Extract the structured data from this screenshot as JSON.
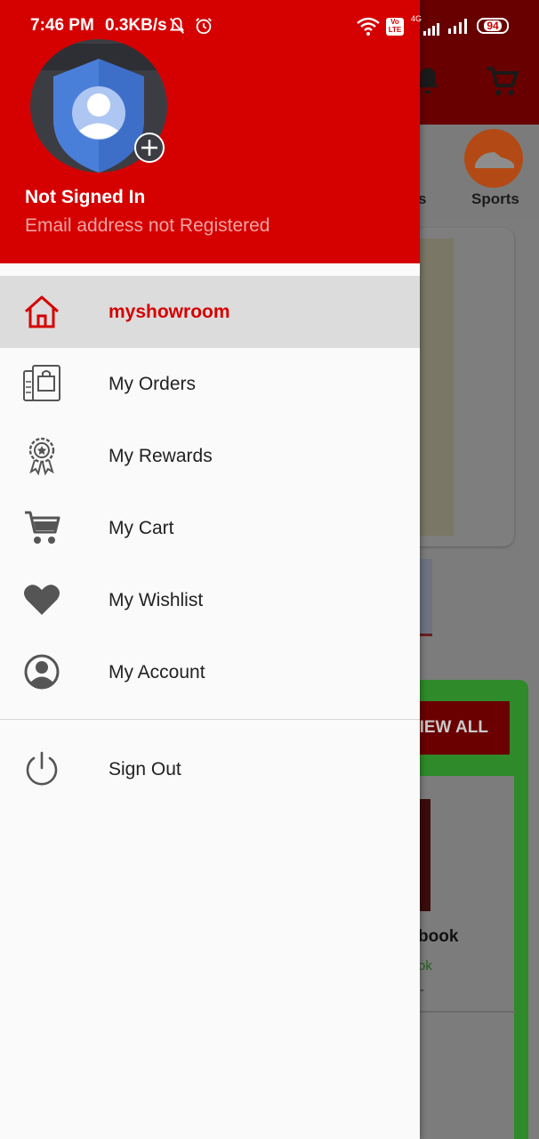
{
  "status_bar": {
    "time": "7:46 PM",
    "speed": "0.3KB/s",
    "network": "4G",
    "volte": "Vo LTE",
    "battery": "94"
  },
  "background": {
    "category_partial_label": "s",
    "category_sports_label": "Sports",
    "view_all_label": "IEW ALL",
    "book_label": "book",
    "ok_label": "ok",
    "dash": "-"
  },
  "drawer": {
    "user_name": "Not Signed In",
    "user_email": "Email address not Registered",
    "menu_items": [
      {
        "label": "myshowroom",
        "icon": "home-icon",
        "active": true
      },
      {
        "label": "My Orders",
        "icon": "orders-icon",
        "active": false
      },
      {
        "label": "My Rewards",
        "icon": "rewards-icon",
        "active": false
      },
      {
        "label": "My Cart",
        "icon": "cart-icon",
        "active": false
      },
      {
        "label": "My Wishlist",
        "icon": "heart-icon",
        "active": false
      },
      {
        "label": "My Account",
        "icon": "account-icon",
        "active": false
      }
    ],
    "sign_out_label": "Sign Out"
  },
  "colors": {
    "header_red": "#d50000",
    "active_text": "#d50000",
    "active_bg": "#dcdcdc",
    "icon_gray": "#555555"
  }
}
